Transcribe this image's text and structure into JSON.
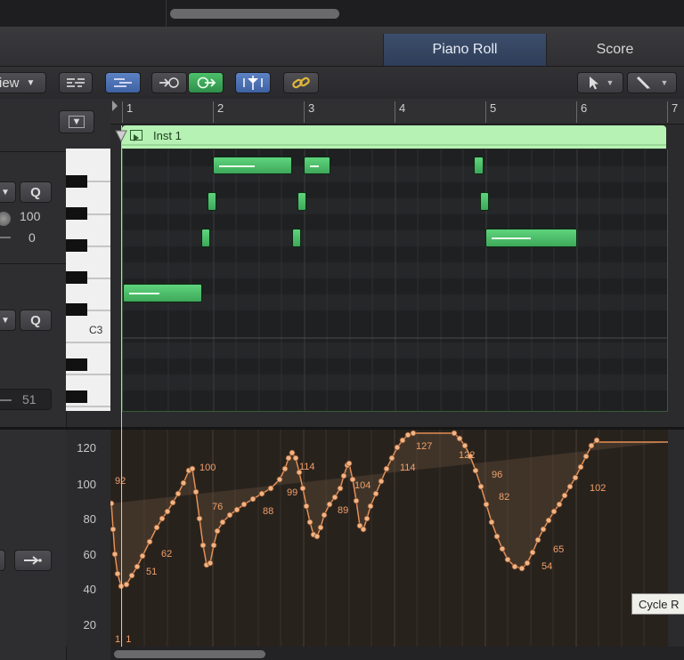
{
  "tabs": [
    {
      "label": "Piano Roll",
      "active": true
    },
    {
      "label": "Score",
      "active": false
    }
  ],
  "toolbar": {
    "view_menu_label": "iew",
    "icons": [
      "quantize-list-icon",
      "midi-draw-icon",
      "midi-in-icon",
      "midi-out-icon",
      "catch-playhead-icon",
      "link-icon",
      "pointer-tool-icon",
      "pencil-tool-icon"
    ]
  },
  "left_panel": {
    "q_label_1": "Q",
    "velocity_value": "100",
    "offset_value": "0",
    "q_label_2": "Q",
    "bottom_value": "51"
  },
  "ruler": {
    "bars": [
      "1",
      "2",
      "3",
      "4",
      "5",
      "6",
      "7"
    ]
  },
  "region": {
    "name": "Inst 1"
  },
  "keyboard": {
    "c_label": "C3"
  },
  "automation": {
    "y_labels": [
      "120",
      "100",
      "80",
      "60",
      "40",
      "20"
    ],
    "point_labels": [
      "92",
      "100",
      "76",
      "62",
      "51",
      "88",
      "99",
      "114",
      "89",
      "104",
      "114",
      "127",
      "122",
      "96",
      "82",
      "65",
      "54",
      "102"
    ],
    "bottom_label": "1  1"
  },
  "tooltip": {
    "text": "Cycle R"
  },
  "colors": {
    "tab_active": "#34476a",
    "note_green": "#4fc06c",
    "region_green": "#b6f2b3",
    "automation_orange": "#f0a06a"
  }
}
